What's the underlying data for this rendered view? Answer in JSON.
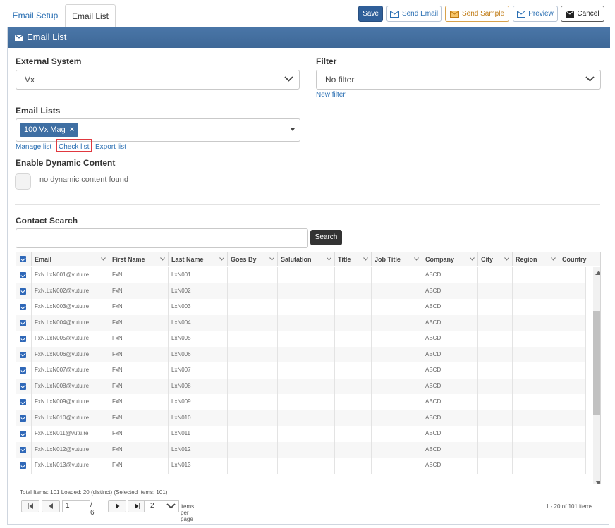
{
  "tabs": {
    "email_setup": "Email Setup",
    "email_list": "Email List"
  },
  "toolbar": {
    "save": "Save",
    "send_email": "Send Email",
    "send_sample": "Send Sample",
    "preview": "Preview",
    "cancel": "Cancel"
  },
  "panel": {
    "title": "Email List",
    "icon": "envelope-icon"
  },
  "form": {
    "external_system_label": "External System",
    "external_system_value": "Vx",
    "filter_label": "Filter",
    "filter_value": "No filter",
    "new_filter": "New filter",
    "email_lists_label": "Email Lists",
    "email_list_chip": "100 Vx Mag",
    "manage_list": "Manage list",
    "check_list": "Check list",
    "export_list": "Export list",
    "dynamic_label": "Enable Dynamic Content",
    "dynamic_none": "no dynamic content found",
    "contact_search_label": "Contact Search",
    "search_button": "Search"
  },
  "grid": {
    "columns": [
      "Email",
      "First Name",
      "Last Name",
      "Goes By",
      "Salutation",
      "Title",
      "Job Title",
      "Company",
      "City",
      "Region",
      "Country"
    ],
    "rows": [
      [
        "FxN.LxN001@vutu.re",
        "FxN",
        "LxN001",
        "ABCD"
      ],
      [
        "FxN.LxN002@vutu.re",
        "FxN",
        "LxN002",
        "ABCD"
      ],
      [
        "FxN.LxN003@vutu.re",
        "FxN",
        "LxN003",
        "ABCD"
      ],
      [
        "FxN.LxN004@vutu.re",
        "FxN",
        "LxN004",
        "ABCD"
      ],
      [
        "FxN.LxN005@vutu.re",
        "FxN",
        "LxN005",
        "ABCD"
      ],
      [
        "FxN.LxN006@vutu.re",
        "FxN",
        "LxN006",
        "ABCD"
      ],
      [
        "FxN.LxN007@vutu.re",
        "FxN",
        "LxN007",
        "ABCD"
      ],
      [
        "FxN.LxN008@vutu.re",
        "FxN",
        "LxN008",
        "ABCD"
      ],
      [
        "FxN.LxN009@vutu.re",
        "FxN",
        "LxN009",
        "ABCD"
      ],
      [
        "FxN.LxN010@vutu.re",
        "FxN",
        "LxN010",
        "ABCD"
      ],
      [
        "FxN.LxN011@vutu.re",
        "FxN",
        "LxN011",
        "ABCD"
      ],
      [
        "FxN.LxN012@vutu.re",
        "FxN",
        "LxN012",
        "ABCD"
      ],
      [
        "FxN.LxN013@vutu.re",
        "FxN",
        "LxN013",
        "ABCD"
      ]
    ]
  },
  "pagination": {
    "summary": "Total Items: 101 Loaded: 20 (distinct) (Selected Items: 101)",
    "page": "1",
    "total_pages": "/ 6",
    "page_size": "2",
    "per_page_label": "items per page",
    "info": "1 - 20 of 101 items"
  }
}
